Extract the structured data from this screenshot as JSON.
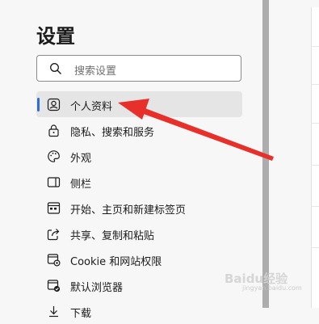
{
  "settings": {
    "title": "设置",
    "search": {
      "placeholder": "搜索设置"
    },
    "items": [
      {
        "label": "个人资料",
        "icon": "profile-icon"
      },
      {
        "label": "隐私、搜索和服务",
        "icon": "lock-icon"
      },
      {
        "label": "外观",
        "icon": "palette-icon"
      },
      {
        "label": "侧栏",
        "icon": "sidebar-icon"
      },
      {
        "label": "开始、主页和新建标签页",
        "icon": "home-page-icon"
      },
      {
        "label": "共享、复制和粘贴",
        "icon": "share-icon"
      },
      {
        "label": "Cookie 和网站权限",
        "icon": "site-permissions-icon"
      },
      {
        "label": "默认浏览器",
        "icon": "default-browser-icon"
      },
      {
        "label": "下载",
        "icon": "download-icon"
      }
    ],
    "active_item": 0
  },
  "watermark": {
    "text": "Baidu经验",
    "sub": "jingyan.baidu.com"
  },
  "colors": {
    "accent": "#2f6fd1",
    "arrow": "#e8302a"
  }
}
